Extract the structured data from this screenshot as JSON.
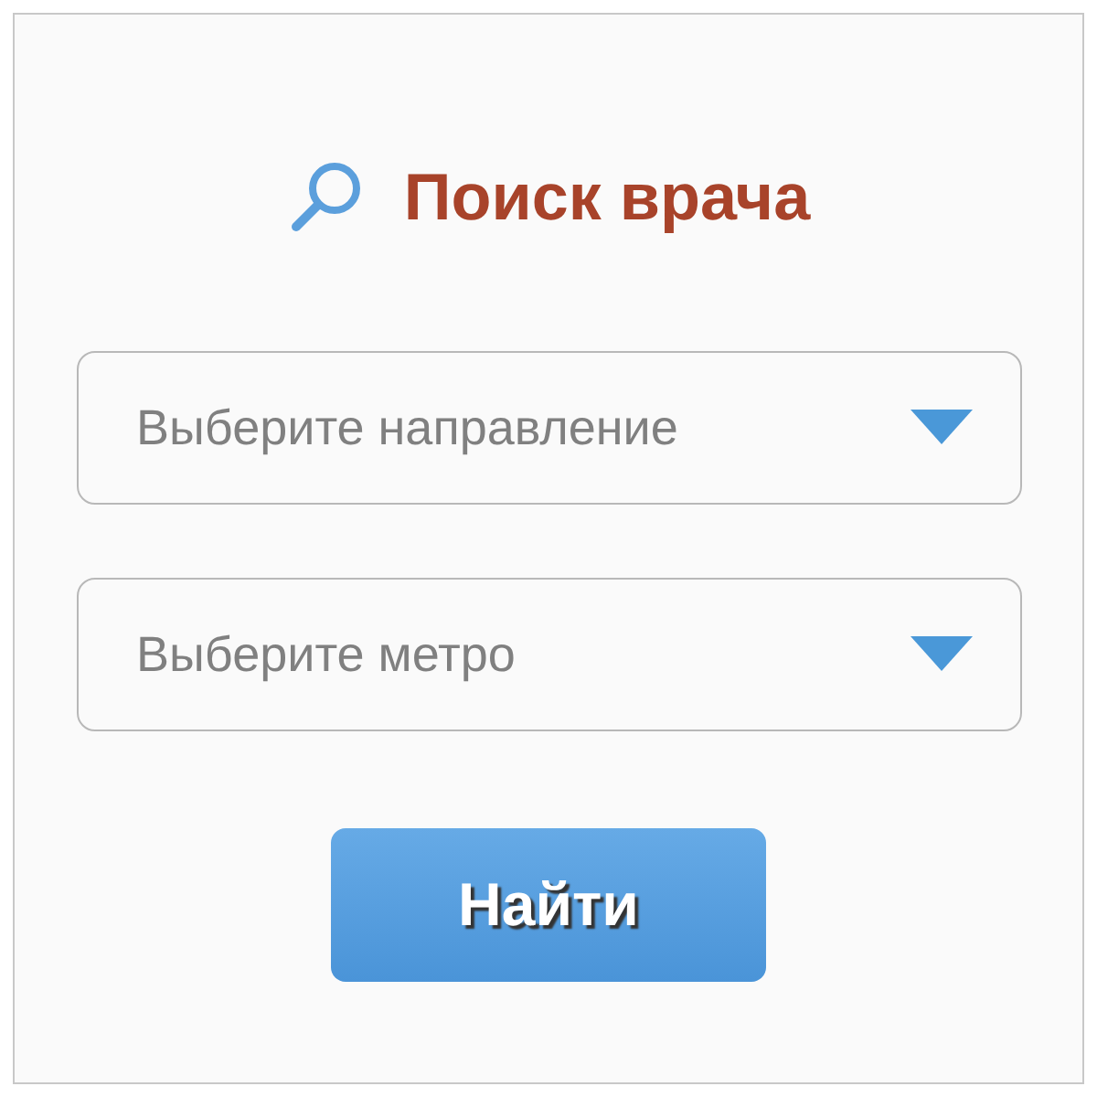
{
  "title": "Поиск врача",
  "dropdowns": [
    {
      "placeholder": "Выберите направление"
    },
    {
      "placeholder": "Выберите метро"
    }
  ],
  "submit_button": {
    "label": "Найти"
  }
}
